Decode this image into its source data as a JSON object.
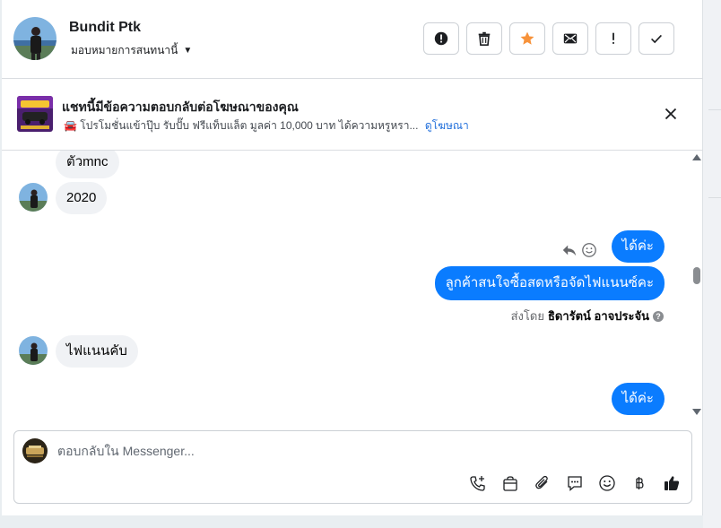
{
  "header": {
    "contact_name": "Bundit Ptk",
    "assign_label": "มอบหมายการสนทนานี้",
    "actions": [
      {
        "name": "spam-button",
        "icon": "alert-circle-icon"
      },
      {
        "name": "delete-button",
        "icon": "trash-icon"
      },
      {
        "name": "star-button",
        "icon": "star-icon"
      },
      {
        "name": "mark-unread-button",
        "icon": "envelope-icon"
      },
      {
        "name": "follow-up-button",
        "icon": "exclamation-icon"
      },
      {
        "name": "mark-done-button",
        "icon": "checkmark-icon"
      }
    ],
    "star_color": "#f7923a"
  },
  "ad_banner": {
    "title": "แชทนี้มีข้อความตอบกลับต่อโฆษณาของคุณ",
    "subtitle": "🚘 โปรโมชั่นแข้าปุ๊บ รับปั๊บ ฟรีแท็บแล็ต มูลค่า 10,000 บาท ได้ความหรูหรา...",
    "link": "ดูโฆษณา"
  },
  "messages": [
    {
      "dir": "in",
      "text": "ตัวmnc"
    },
    {
      "dir": "in",
      "text": "2020"
    },
    {
      "dir": "out",
      "text": "ได้ค่ะ"
    },
    {
      "dir": "out",
      "text": "ลูกค้าสนใจซื้อสดหรือจัดไฟแนนซ์คะ"
    },
    {
      "dir": "in",
      "text": "ไฟแนนคับ"
    },
    {
      "dir": "out",
      "text": "ได้ค่ะ"
    }
  ],
  "sent_by": {
    "prefix": "ส่งโดย",
    "name": "ธิดารัตน์ อาจประจัน",
    "info": "?"
  },
  "composer": {
    "placeholder": "ตอบกลับใน Messenger..."
  },
  "colors": {
    "outgoing_bubble": "#0a7cff",
    "incoming_bubble": "#f0f2f5",
    "link": "#216fdb"
  }
}
